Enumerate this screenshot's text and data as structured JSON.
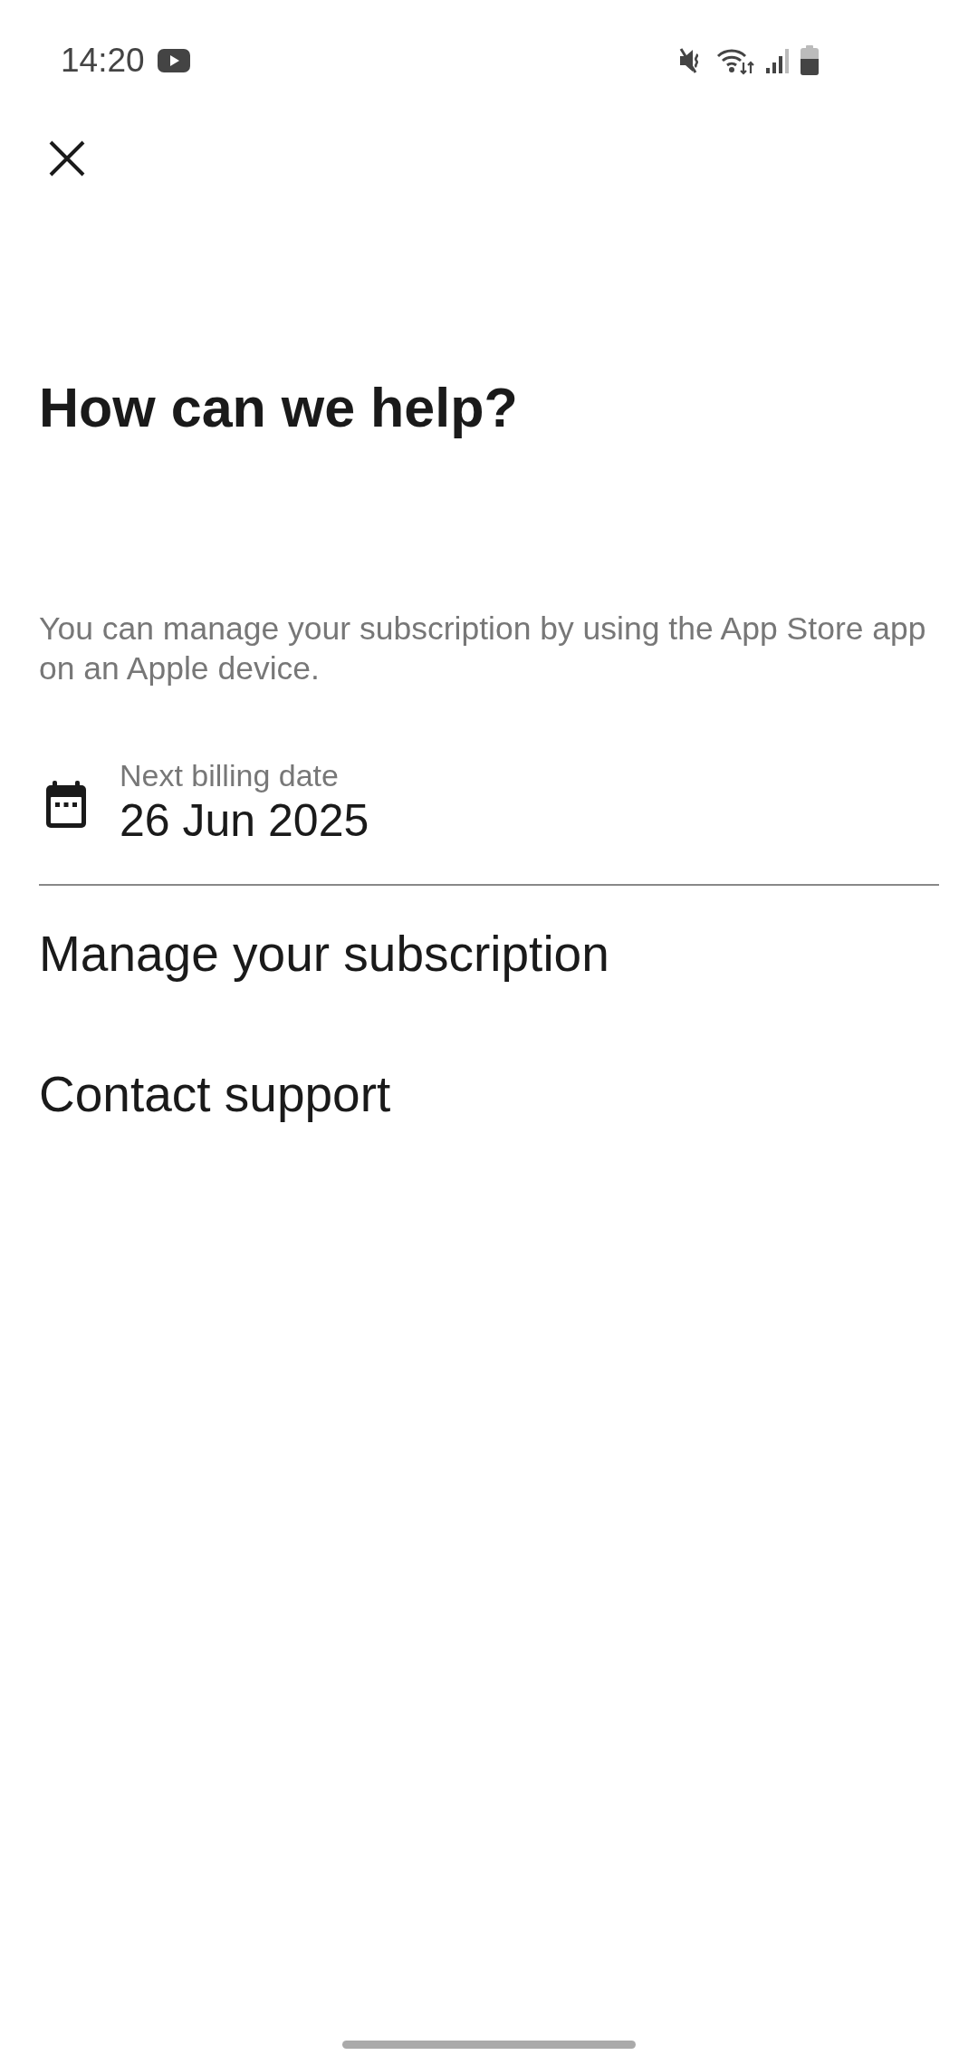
{
  "status_bar": {
    "time": "14:20"
  },
  "title": "How can we help?",
  "info": "You can manage your subscription by using the App Store app on an Apple device.",
  "billing": {
    "label": "Next billing date",
    "value": "26 Jun 2025"
  },
  "actions": [
    "Manage your subscription",
    "Contact support"
  ]
}
